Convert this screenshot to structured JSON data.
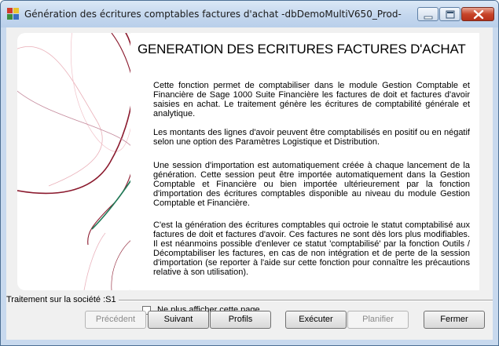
{
  "window": {
    "title": "Génération des écritures comptables factures d'achat -dbDemoMultiV650_Prod-"
  },
  "heading": "GENERATION DES ECRITURES FACTURES D'ACHAT",
  "paragraphs": [
    "Cette fonction permet de comptabiliser dans le module Gestion Comptable et Financière de Sage 1000 Suite Financière les factures de doit et factures d'avoir saisies en achat. Le traitement génère les écritures de comptabilité générale et analytique.",
    "Les montants des lignes d'avoir peuvent être comptabilisés en positif ou en négatif selon une option des Paramètres Logistique et Distribution.",
    "Une session d'importation est automatiquement créée à chaque lancement de la génération. Cette session peut être importée automatiquement dans la Gestion Comptable et Financière ou bien importée ultérieurement par la fonction d'importation des écritures comptables disponible au niveau du module Gestion Comptable et Financière.",
    "C'est la génération des écritures comptables qui octroie le statut comptabilisé aux factures de doit et factures d'avoir. Ces factures ne sont dès lors plus modifiables. Il est néanmoins possible d'enlever ce statut 'comptabilisé' par la fonction Outils / Décomptabiliser les factures, en cas de non intégration et de perte de la session d'importation (se reporter à l'aide sur cette fonction pour connaître les précautions relative à son utilisation)."
  ],
  "checkbox": {
    "label": "Ne plus afficher cette page",
    "checked": false
  },
  "company_label": "Traitement sur la société :S1",
  "buttons": {
    "previous": "Précédent",
    "next": "Suivant",
    "profiles": "Profils",
    "execute": "Exécuter",
    "schedule": "Planifier",
    "close": "Fermer"
  },
  "colors": {
    "title_bar": "#c4d7ee",
    "close_button": "#c8452a",
    "art_curve_red": "#8b1a2e",
    "art_curve_green": "#1f7a57"
  }
}
